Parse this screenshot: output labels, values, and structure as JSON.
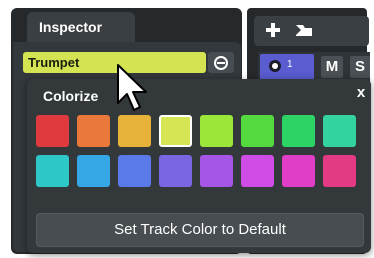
{
  "inspector": {
    "tab_label": "Inspector",
    "track_name": "Trumpet",
    "edit_icon": "edit-icon"
  },
  "track_list": {
    "add_track_icon": "plus-icon",
    "add_track_menu_icon": "add-track-from-template-icon",
    "track_number": "1",
    "mute_label": "M",
    "solo_label": "S",
    "track_color": "#5a5cd0"
  },
  "colorize": {
    "title": "Colorize",
    "close_label": "x",
    "selected_index": 3,
    "swatches": [
      "#e13a3e",
      "#ea783a",
      "#e7b23a",
      "#d6e553",
      "#9ae73a",
      "#54d93f",
      "#2ed365",
      "#33d3a0",
      "#2ec7c8",
      "#35a7e5",
      "#5b7ae9",
      "#7a65e2",
      "#a556e6",
      "#d04ce6",
      "#e03ec6",
      "#e33a83"
    ],
    "default_button_label": "Set Track Color to Default"
  },
  "colors": {
    "panel_bg": "#26292c",
    "popup_bg": "#33383b",
    "track_name_field": "#d3e352"
  }
}
